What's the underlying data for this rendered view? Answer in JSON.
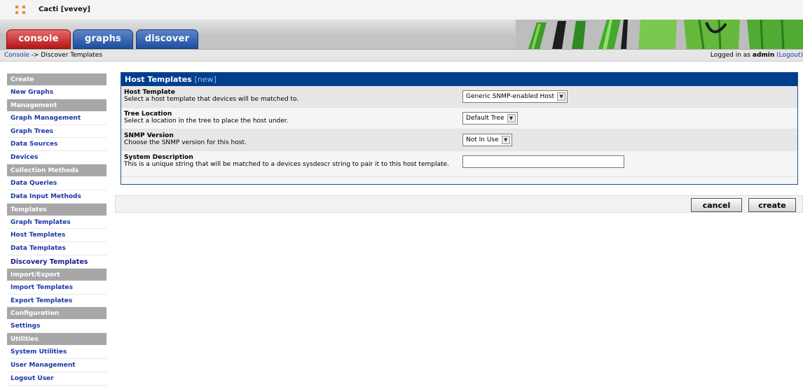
{
  "window": {
    "title": "Cacti [vevey]"
  },
  "tabs": [
    {
      "label": "console",
      "active": true,
      "color": "#b41717"
    },
    {
      "label": "graphs",
      "active": false,
      "color": "#1d4ea0"
    },
    {
      "label": "discover",
      "active": false,
      "color": "#1d4ea0"
    }
  ],
  "breadcrumb": {
    "root": "Console",
    "separator": "->",
    "current": "Discover Templates"
  },
  "login": {
    "prefix": "Logged in as",
    "user": "admin",
    "logout": "(Logout)"
  },
  "sidebar": {
    "sections": [
      {
        "header": "Create",
        "items": [
          "New Graphs"
        ]
      },
      {
        "header": "Management",
        "items": [
          "Graph Management",
          "Graph Trees",
          "Data Sources",
          "Devices"
        ]
      },
      {
        "header": "Collection Methods",
        "items": [
          "Data Queries",
          "Data Input Methods"
        ]
      },
      {
        "header": "Templates",
        "items": [
          "Graph Templates",
          "Host Templates",
          "Data Templates",
          "Discovery Templates"
        ]
      },
      {
        "header": "Import/Export",
        "items": [
          "Import Templates",
          "Export Templates"
        ]
      },
      {
        "header": "Configuration",
        "items": [
          "Settings"
        ]
      },
      {
        "header": "Utilities",
        "items": [
          "System Utilities",
          "User Management",
          "Logout User"
        ]
      }
    ],
    "active_item": "Discovery Templates"
  },
  "panel": {
    "title": "Host Templates",
    "title_suffix": "[new]",
    "fields": [
      {
        "label": "Host Template",
        "description": "Select a host template that devices will be matched to.",
        "type": "select",
        "value": "Generic SNMP-enabled Host"
      },
      {
        "label": "Tree Location",
        "description": "Select a location in the tree to place the host under.",
        "type": "select",
        "value": "Default Tree"
      },
      {
        "label": "SNMP Version",
        "description": "Choose the SNMP version for this host.",
        "type": "select",
        "value": "Not In Use"
      },
      {
        "label": "System Description",
        "description": "This is a unique string that will be matched to a devices sysdescr string to pair it to this host template.",
        "type": "text",
        "value": ""
      }
    ]
  },
  "buttons": {
    "cancel": "cancel",
    "create": "create"
  },
  "colors": {
    "panel_header": "#003e8e",
    "link": "#1a37a8",
    "sidebar_header": "#a7a7a7"
  }
}
